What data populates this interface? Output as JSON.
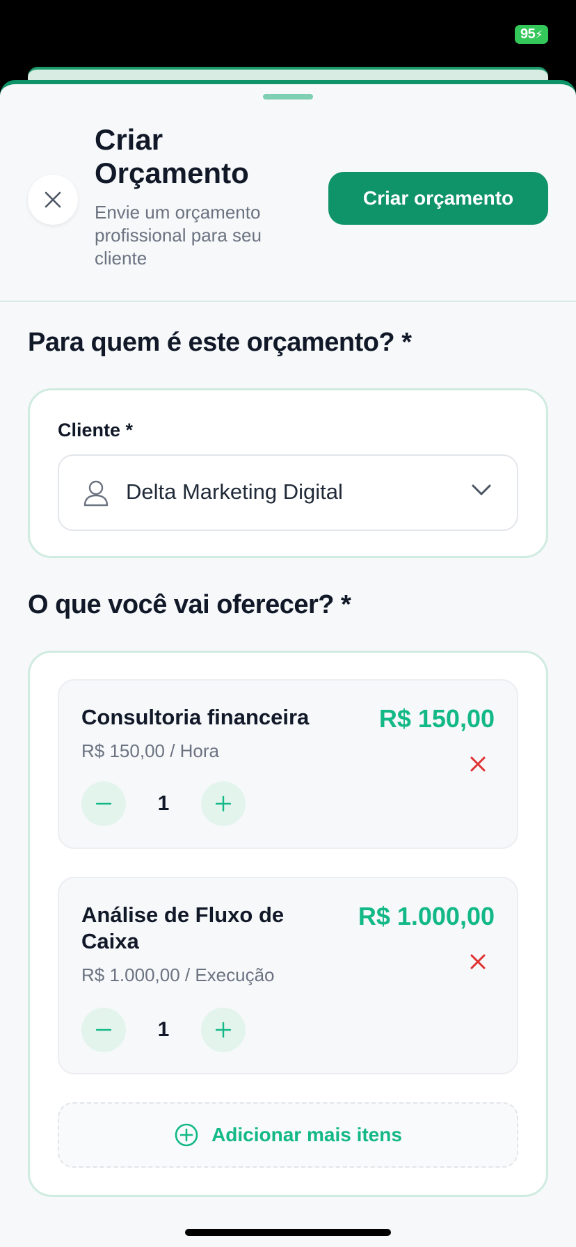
{
  "status": {
    "battery": "95"
  },
  "header": {
    "title": "Criar Orçamento",
    "subtitle": "Envie um orçamento profissional para seu cliente",
    "create_button": "Criar orçamento"
  },
  "client_section": {
    "title": "Para quem é este orçamento? *",
    "field_label": "Cliente *",
    "selected_client": "Delta Marketing Digital"
  },
  "items_section": {
    "title": "O que você vai oferecer? *",
    "items": [
      {
        "name": "Consultoria financeira",
        "unit_price": "R$ 150,00 / Hora",
        "total": "R$ 150,00",
        "quantity": "1"
      },
      {
        "name": "Análise de Fluxo de Caixa",
        "unit_price": "R$ 1.000,00 / Execução",
        "total": "R$ 1.000,00",
        "quantity": "1"
      }
    ],
    "add_more": "Adicionar mais itens"
  },
  "colors": {
    "brand": "#0f9368",
    "accent": "#12b886",
    "danger": "#e03131"
  }
}
